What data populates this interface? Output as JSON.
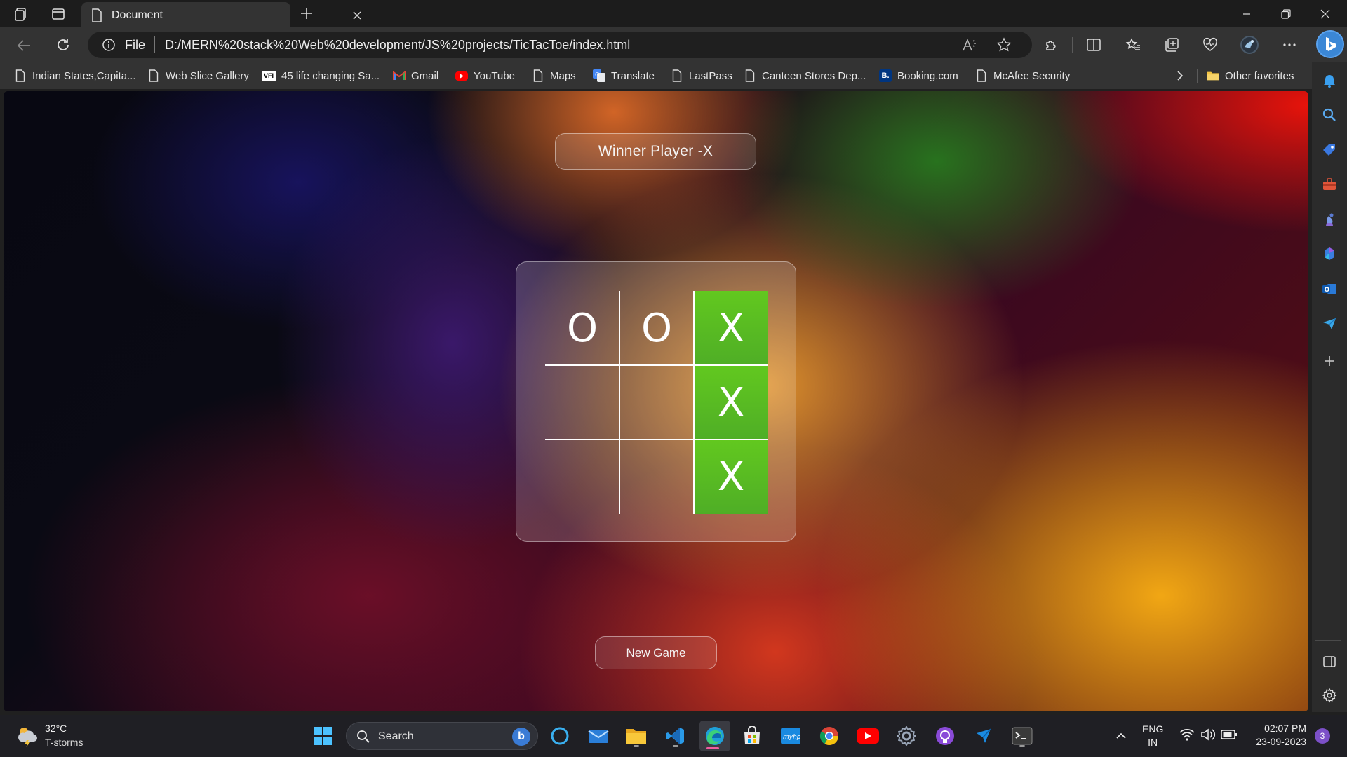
{
  "browser": {
    "tab_title": "Document",
    "address_scheme": "File",
    "address_url": "D:/MERN%20stack%20Web%20development/JS%20projects/TicTacToe/index.html",
    "bookmarks": [
      {
        "label": "Indian States,Capita...",
        "icon": "page-icon"
      },
      {
        "label": "Web Slice Gallery",
        "icon": "page-icon"
      },
      {
        "label": "45 life changing Sa...",
        "icon": "vfi-icon"
      },
      {
        "label": "Gmail",
        "icon": "gmail-icon"
      },
      {
        "label": "YouTube",
        "icon": "youtube-icon"
      },
      {
        "label": "Maps",
        "icon": "page-icon"
      },
      {
        "label": "Translate",
        "icon": "translate-icon"
      },
      {
        "label": "LastPass",
        "icon": "page-icon"
      },
      {
        "label": "Canteen Stores Dep...",
        "icon": "page-icon"
      },
      {
        "label": "Booking.com",
        "icon": "booking-icon"
      },
      {
        "label": "McAfee Security",
        "icon": "page-icon"
      }
    ],
    "other_favorites": "Other favorites",
    "vfi_text": "VFI",
    "booking_letter": "B."
  },
  "game": {
    "winner_message": "Winner Player -X",
    "board": [
      "O",
      "O",
      "X",
      "",
      "",
      "X",
      "",
      "",
      "X"
    ],
    "winning_cells": [
      2,
      5,
      8
    ],
    "new_game_label": "New Game",
    "win_color": "#5cbf22"
  },
  "taskbar": {
    "weather_temp": "32°C",
    "weather_desc": "T-storms",
    "search_label": "Search",
    "search_bing_letter": "b",
    "lang_line1": "ENG",
    "lang_line2": "IN",
    "time": "02:07 PM",
    "date": "23-09-2023",
    "notification_count": "3"
  }
}
